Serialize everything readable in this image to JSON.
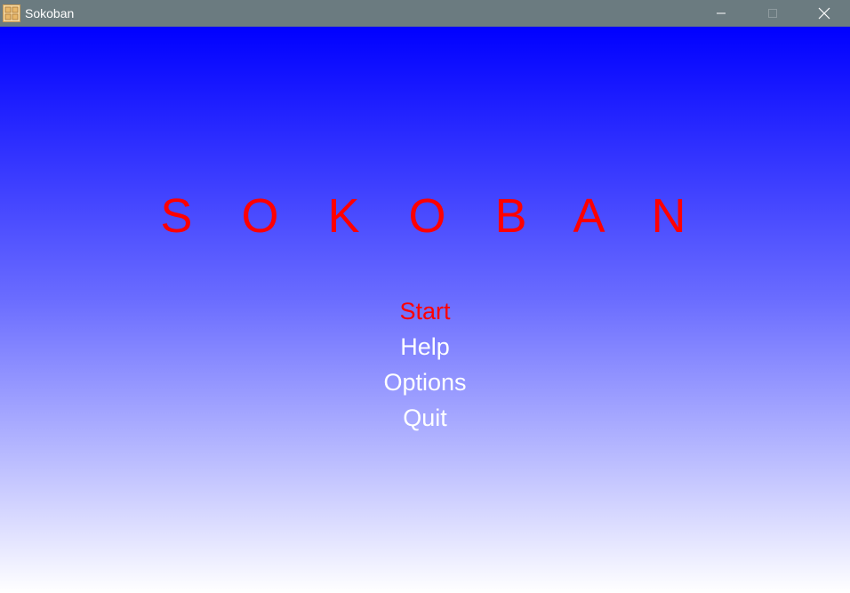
{
  "window": {
    "title": "Sokoban",
    "icon": "sokoban-app-icon",
    "controls": [
      "minimize-icon",
      "maximize-icon",
      "close-icon"
    ]
  },
  "game": {
    "title": "S O K O B A N",
    "title_color": "#ff0000"
  },
  "menu": {
    "items": [
      {
        "label": "Start",
        "selected": true
      },
      {
        "label": "Help",
        "selected": false
      },
      {
        "label": "Options",
        "selected": false
      },
      {
        "label": "Quit",
        "selected": false
      }
    ],
    "selected_color": "#ff0000",
    "default_color": "#ffffff"
  },
  "colors": {
    "titlebar": "#6b7b80",
    "background_top": "#0000ff",
    "background_bottom": "#ffffff"
  }
}
